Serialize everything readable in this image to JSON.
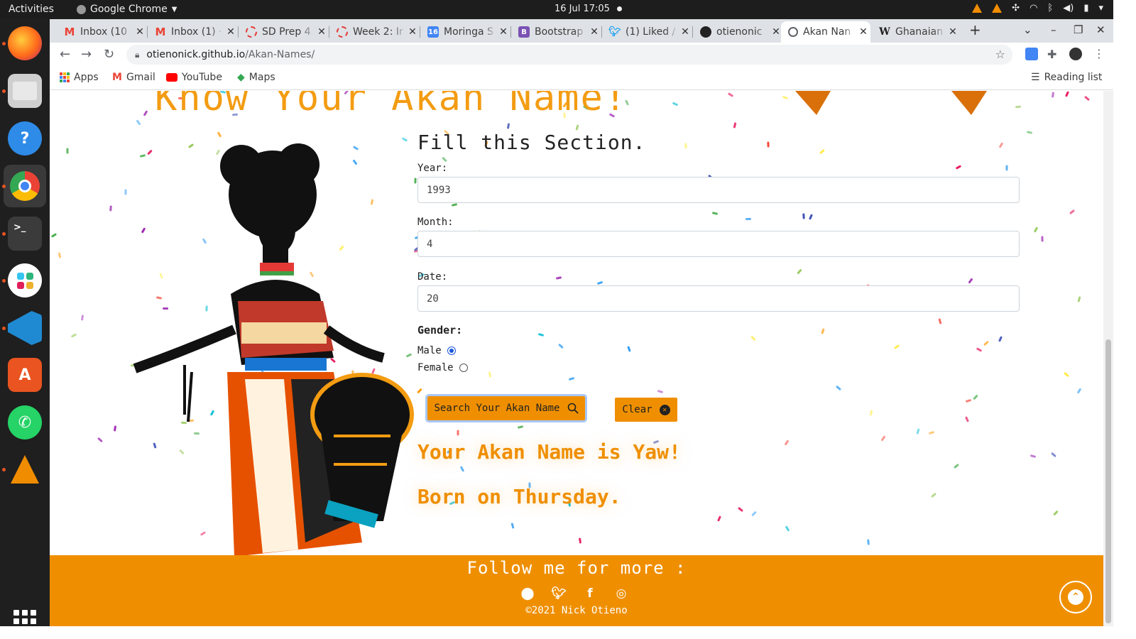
{
  "system": {
    "activities": "Activities",
    "app_name": "Google Chrome",
    "clock": "16 Jul  17:05"
  },
  "dock": {
    "icons": [
      "firefox-icon",
      "files-icon",
      "help-icon",
      "chrome-icon",
      "terminal-icon",
      "slack-icon",
      "vscode-icon",
      "software-icon",
      "whatsapp-icon",
      "vlc-icon",
      "app-grid-icon"
    ]
  },
  "tabs": [
    {
      "label": "Inbox (10",
      "favicon": "gmail"
    },
    {
      "label": "Inbox (1) ·",
      "favicon": "gmail"
    },
    {
      "label": "SD Prep 4",
      "favicon": "moringa"
    },
    {
      "label": "Week 2: Ir",
      "favicon": "moringa"
    },
    {
      "label": "Moringa S",
      "favicon": "calendar"
    },
    {
      "label": "Bootstrap",
      "favicon": "bootstrap"
    },
    {
      "label": "(1) Liked /",
      "favicon": "twitter"
    },
    {
      "label": "otienonic",
      "favicon": "github"
    },
    {
      "label": "Akan Nan",
      "favicon": "globe",
      "active": true
    },
    {
      "label": "Ghanaian",
      "favicon": "wikipedia"
    }
  ],
  "toolbar": {
    "url_host": "otienonick.github.io",
    "url_path": "/Akan-Names/"
  },
  "bookmarks": {
    "items": [
      "Apps",
      "Gmail",
      "YouTube",
      "Maps"
    ],
    "reading_list": "Reading list"
  },
  "page": {
    "hero_title": "Know Your Akan Name!",
    "form_title": "Fill this Section.",
    "year_label": "Year:",
    "year_value": "1993",
    "month_label": "Month:",
    "month_value": "4",
    "date_label": "Date:",
    "date_value": "20",
    "gender_label": "Gender:",
    "gender_options": [
      "Male",
      "Female"
    ],
    "gender_selected": "Male",
    "search_button": "Search Your Akan Name",
    "clear_button": "Clear",
    "result_name": "Your Akan Name is Yaw!",
    "result_day": "Born on Thursday."
  },
  "footer": {
    "follow": "Follow me for more :",
    "socials": [
      "github-icon",
      "twitter-icon",
      "facebook-icon",
      "instagram-icon"
    ],
    "copyright": "©2021 Nick Otieno"
  },
  "colors": {
    "accent": "#ef8f00",
    "title_orange": "#f39c12"
  }
}
